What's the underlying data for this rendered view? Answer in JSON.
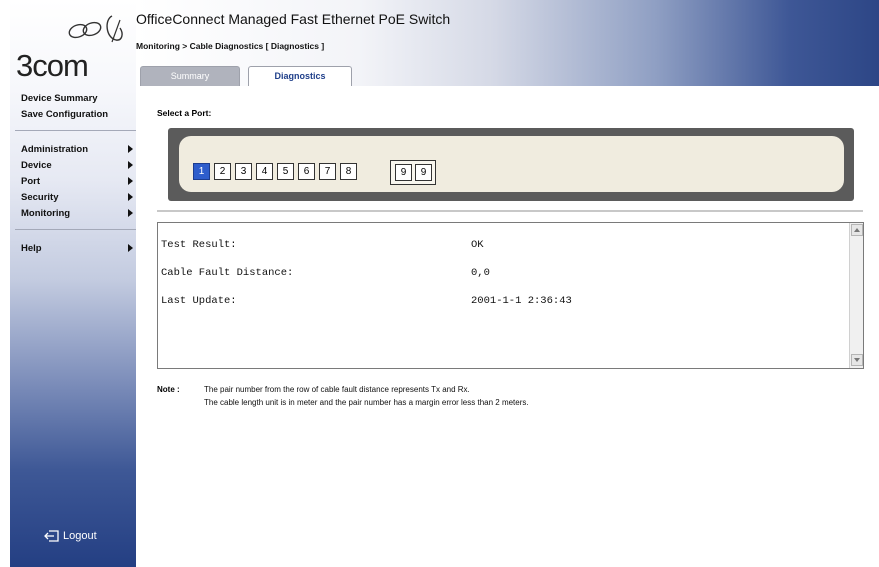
{
  "sidebar": {
    "logo_text": "3com",
    "links": [
      "Device Summary",
      "Save Configuration"
    ],
    "menu": [
      "Administration",
      "Device",
      "Port",
      "Security",
      "Monitoring"
    ],
    "help": "Help",
    "logout": "Logout"
  },
  "header": {
    "title": "OfficeConnect Managed Fast Ethernet PoE Switch",
    "breadcrumb": "Monitoring > Cable Diagnostics [ Diagnostics ]",
    "tabs": [
      "Summary",
      "Diagnostics"
    ],
    "active_tab": "Diagnostics"
  },
  "main": {
    "select_port_label": "Select a Port:",
    "ports": [
      "1",
      "2",
      "3",
      "4",
      "5",
      "6",
      "7",
      "8"
    ],
    "combo_ports": [
      "9",
      "9"
    ],
    "selected_port": "1",
    "results": {
      "test_result_label": "Test Result:",
      "test_result_value": "OK",
      "fault_distance_label": "Cable Fault Distance:",
      "fault_distance_value": "0,0",
      "last_update_label": "Last Update:",
      "last_update_value": "2001-1-1 2:36:43"
    },
    "note_label": "Note :",
    "note_lines": [
      "The pair number from the row of cable fault distance represents Tx and Rx.",
      "The cable length unit is in meter and the pair number has a margin error less than 2 meters."
    ]
  },
  "colors": {
    "selected_port": "#2e5dcc",
    "sidebar_bottom": "#243f83",
    "header_right": "#2d4686",
    "active_tab_text": "#1f3f8a"
  }
}
